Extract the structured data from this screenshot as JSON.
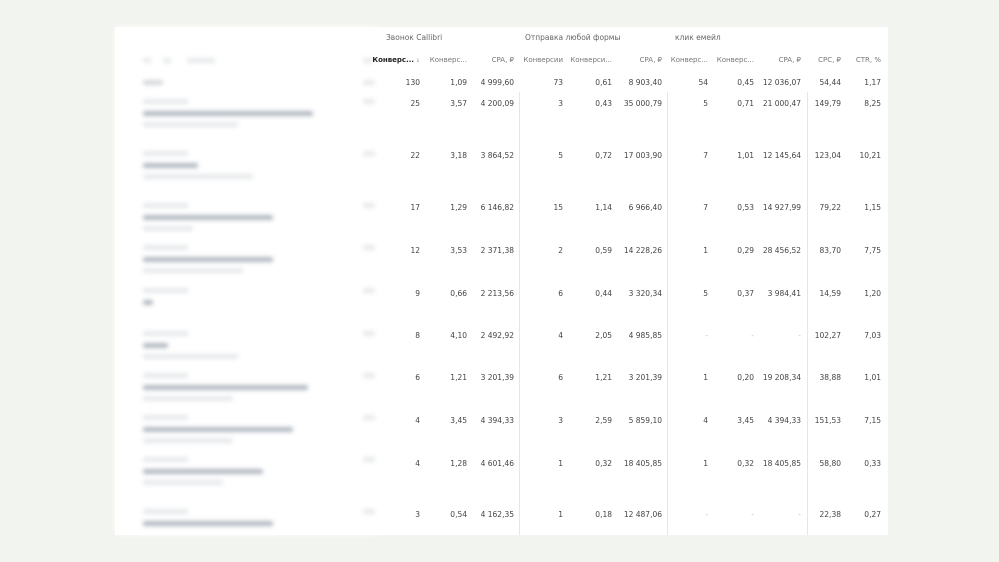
{
  "groups": [
    {
      "label": "Звонок Callibri"
    },
    {
      "label": "Отправка любой формы"
    },
    {
      "label": "клик емейл"
    }
  ],
  "columns": [
    {
      "label": "Конверс...",
      "sorted": true,
      "sort_icon": "sort-arrow-icon"
    },
    {
      "label": "Конверс..."
    },
    {
      "label": "CPA, ₽"
    },
    {
      "label": "Конверсии"
    },
    {
      "label": "Конверси..."
    },
    {
      "label": "CPA, ₽"
    },
    {
      "label": "Конверс..."
    },
    {
      "label": "Конверс..."
    },
    {
      "label": "CPA, ₽"
    },
    {
      "label": "CPC, ₽"
    },
    {
      "label": "CTR, %"
    }
  ],
  "total_row": [
    "130",
    "1,09",
    "4 999,60",
    "73",
    "0,61",
    "8 903,40",
    "54",
    "0,45",
    "12 036,07",
    "54,44",
    "1,17"
  ],
  "rows": [
    [
      "25",
      "3,57",
      "4 200,09",
      "3",
      "0,43",
      "35 000,79",
      "5",
      "0,71",
      "21 000,47",
      "149,79",
      "8,25"
    ],
    [
      "22",
      "3,18",
      "3 864,52",
      "5",
      "0,72",
      "17 003,90",
      "7",
      "1,01",
      "12 145,64",
      "123,04",
      "10,21"
    ],
    [
      "17",
      "1,29",
      "6 146,82",
      "15",
      "1,14",
      "6 966,40",
      "7",
      "0,53",
      "14 927,99",
      "79,22",
      "1,15"
    ],
    [
      "12",
      "3,53",
      "2 371,38",
      "2",
      "0,59",
      "14 228,26",
      "1",
      "0,29",
      "28 456,52",
      "83,70",
      "7,75"
    ],
    [
      "9",
      "0,66",
      "2 213,56",
      "6",
      "0,44",
      "3 320,34",
      "5",
      "0,37",
      "3 984,41",
      "14,59",
      "1,20"
    ],
    [
      "8",
      "4,10",
      "2 492,92",
      "4",
      "2,05",
      "4 985,85",
      "-",
      "-",
      "-",
      "102,27",
      "7,03"
    ],
    [
      "6",
      "1,21",
      "3 201,39",
      "6",
      "1,21",
      "3 201,39",
      "1",
      "0,20",
      "19 208,34",
      "38,88",
      "1,01"
    ],
    [
      "4",
      "3,45",
      "4 394,33",
      "3",
      "2,59",
      "5 859,10",
      "4",
      "3,45",
      "4 394,33",
      "151,53",
      "7,15"
    ],
    [
      "4",
      "1,28",
      "4 601,46",
      "1",
      "0,32",
      "18 405,85",
      "1",
      "0,32",
      "18 405,85",
      "58,80",
      "0,33"
    ],
    [
      "3",
      "0,54",
      "4 162,35",
      "1",
      "0,18",
      "12 487,06",
      "-",
      "-",
      "-",
      "22,38",
      "0,27"
    ]
  ]
}
